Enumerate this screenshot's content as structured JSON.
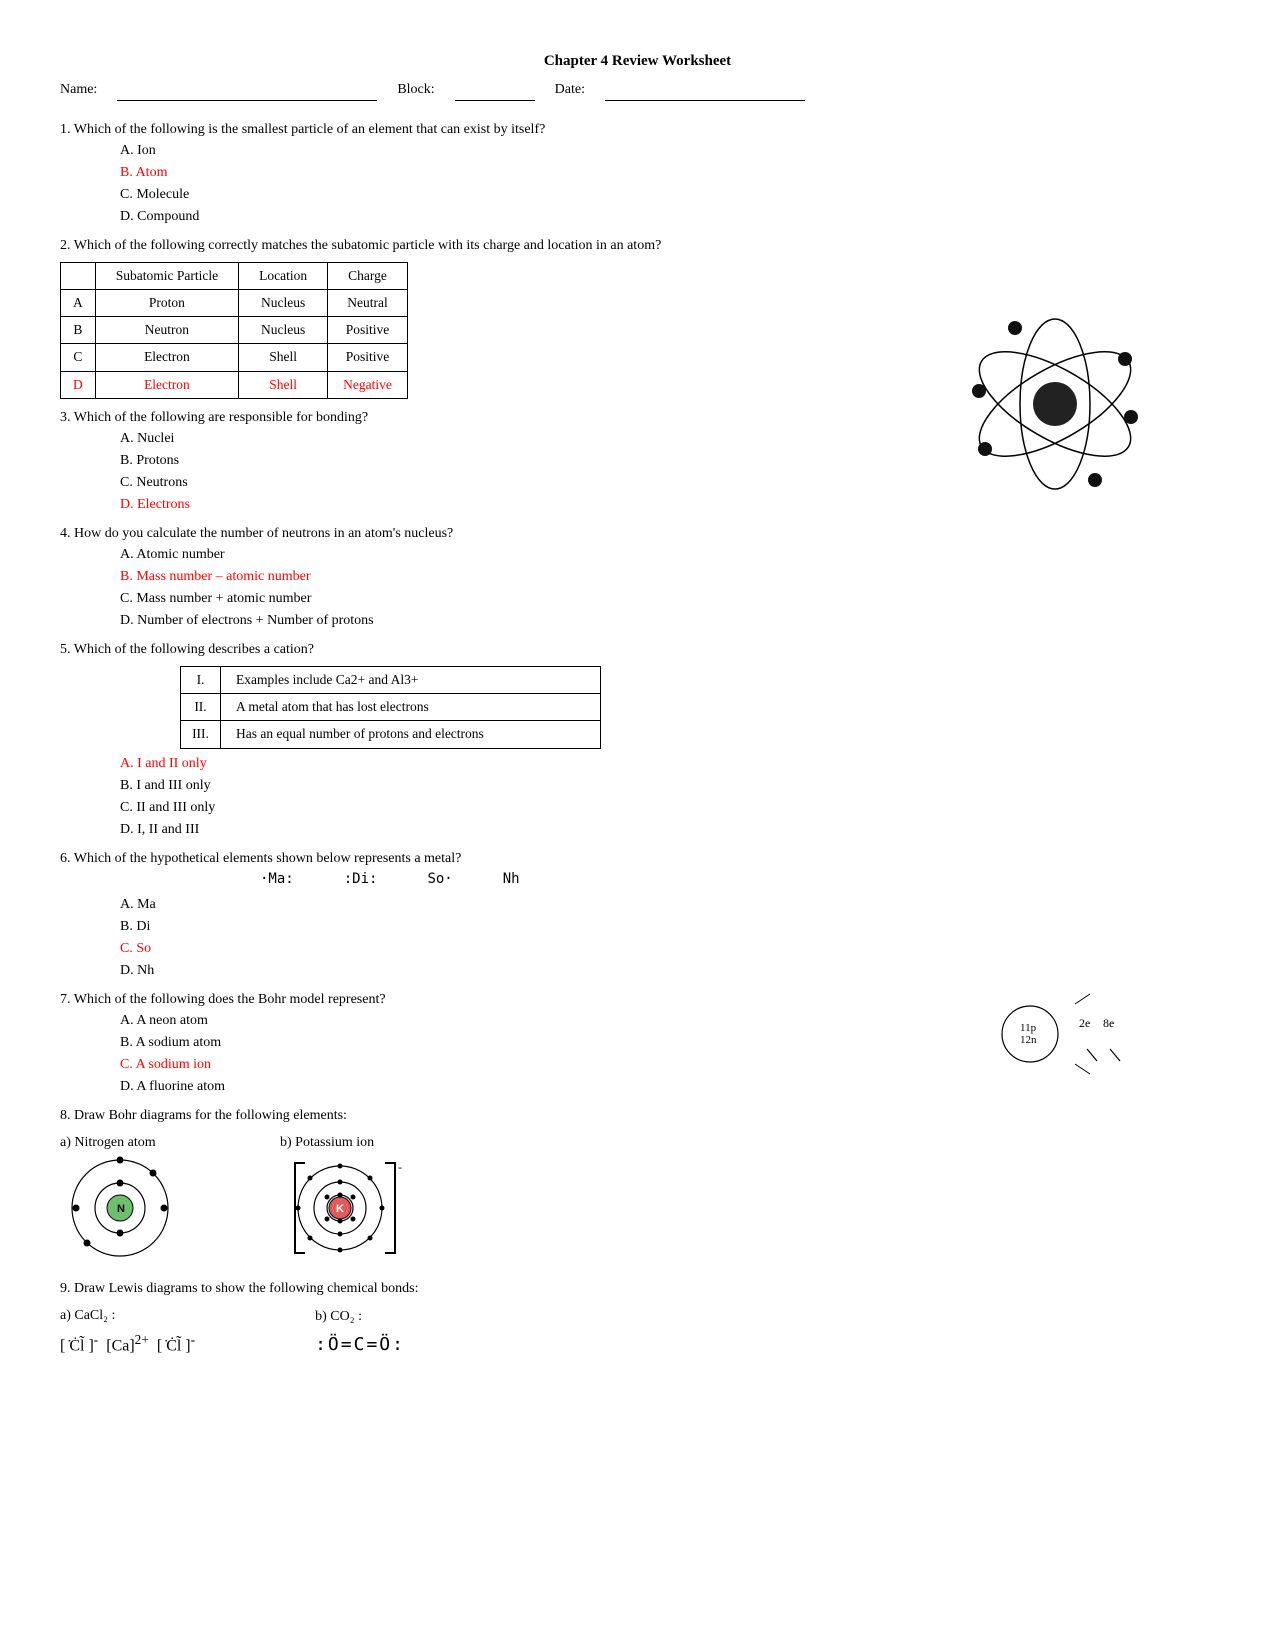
{
  "title": "Chapter 4 Review Worksheet",
  "header": {
    "name_label": "Name:",
    "block_label": "Block:",
    "date_label": "Date:"
  },
  "q1": {
    "text": "1. Which of the following is the smallest particle of an element that can exist by itself?",
    "options": [
      {
        "label": "A. Ion",
        "red": false
      },
      {
        "label": "B. Atom",
        "red": true
      },
      {
        "label": "C. Molecule",
        "red": false
      },
      {
        "label": "D. Compound",
        "red": false
      }
    ]
  },
  "q2": {
    "text": "2. Which of the following correctly matches the subatomic particle with its charge and location in an atom?",
    "table_headers": [
      "",
      "Subatomic Particle",
      "Location",
      "Charge"
    ],
    "table_rows": [
      {
        "row_label": "A",
        "particle": "Proton",
        "location": "Nucleus",
        "charge": "Neutral",
        "red": false
      },
      {
        "row_label": "B",
        "particle": "Neutron",
        "location": "Nucleus",
        "charge": "Positive",
        "red": false
      },
      {
        "row_label": "C",
        "particle": "Electron",
        "location": "Shell",
        "charge": "Positive",
        "red": false
      },
      {
        "row_label": "D",
        "particle": "Electron",
        "location": "Shell",
        "charge": "Negative",
        "red": true
      }
    ]
  },
  "q3": {
    "text": "3. Which of the following are responsible for bonding?",
    "options": [
      {
        "label": "A. Nuclei",
        "red": false
      },
      {
        "label": "B. Protons",
        "red": false
      },
      {
        "label": "C. Neutrons",
        "red": false
      },
      {
        "label": "D. Electrons",
        "red": true
      }
    ]
  },
  "q4": {
    "text": "4. How do you calculate the number of neutrons in an atom’s nucleus?",
    "options": [
      {
        "label": "A. Atomic number",
        "red": false
      },
      {
        "label": "B. Mass number – atomic number",
        "red": true
      },
      {
        "label": "C. Mass number + atomic number",
        "red": false
      },
      {
        "label": "D. Number of electrons + Number of protons",
        "red": false
      }
    ]
  },
  "q5": {
    "text": "5. Which of the following describes a cation?",
    "cation_rows": [
      {
        "num": "I.",
        "desc": "Examples include Ca2+ and Al3+"
      },
      {
        "num": "II.",
        "desc": "A metal atom that has lost electrons"
      },
      {
        "num": "III.",
        "desc": "Has an equal number of protons and electrons"
      }
    ],
    "options": [
      {
        "label": "A. I and II only",
        "red": true
      },
      {
        "label": "B. I and III only",
        "red": false
      },
      {
        "label": "C. II and III only",
        "red": false
      },
      {
        "label": "D. I, II and III",
        "red": false
      }
    ]
  },
  "q6": {
    "text": "6. Which of the hypothetical elements shown below represents a metal?",
    "options": [
      {
        "label": "A.  Ma",
        "red": false
      },
      {
        "label": "B.  Di",
        "red": false
      },
      {
        "label": "C. So",
        "red": true
      },
      {
        "label": "D. Nh",
        "red": false
      }
    ]
  },
  "q7": {
    "text": "7. Which of the following does the Bohr model represent?",
    "options": [
      {
        "label": "A. A neon atom",
        "red": false
      },
      {
        "label": "B. A sodium atom",
        "red": false
      },
      {
        "label": "C. A sodium ion",
        "red": true
      },
      {
        "label": "D. A fluorine atom",
        "red": false
      }
    ]
  },
  "q8": {
    "text": "8. Draw Bohr diagrams for the following elements:",
    "a_label": "a) Nitrogen atom",
    "b_label": "b) Potassium ion"
  },
  "q9": {
    "text": "9. Draw Lewis diagrams to show the following chemical bonds:",
    "a_label": "a) CaCl₂ :",
    "b_label": "b) CO₂ :"
  }
}
